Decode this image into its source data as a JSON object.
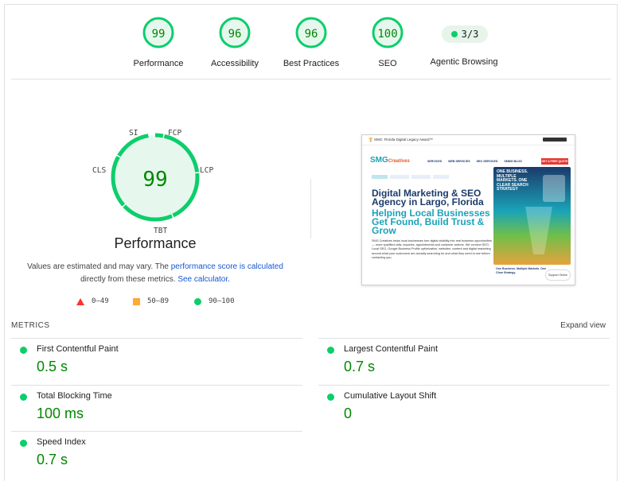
{
  "gauges": [
    {
      "label": "Performance",
      "score": "99"
    },
    {
      "label": "Accessibility",
      "score": "96"
    },
    {
      "label": "Best Practices",
      "score": "96"
    },
    {
      "label": "SEO",
      "score": "100"
    }
  ],
  "agentic": {
    "value": "3/3",
    "label": "Agentic Browsing"
  },
  "performance": {
    "score": "99",
    "title": "Performance",
    "metric_labels": {
      "si": "SI",
      "fcp": "FCP",
      "lcp": "LCP",
      "tbt": "TBT",
      "cls": "CLS"
    },
    "note_prefix": "Values are estimated and may vary. The ",
    "note_link1": "performance score is calculated",
    "note_middle": " directly from these metrics. ",
    "note_link2": "See calculator",
    "note_suffix": ".",
    "legend": [
      "0–49",
      "50–89",
      "90–100"
    ]
  },
  "screenshot": {
    "top_bar": "🏆 SMG: Florida Digital Legacy Award™",
    "logo": "SMG",
    "logo_script": "Creatives",
    "nav": [
      "SERVICES",
      "WEB SERVICES",
      "SEO SERVICES",
      "SMMG BLOG"
    ],
    "cta": "GET A FREE QUOTE",
    "heading_dark": "Digital Marketing & SEO Agency in Largo, Florida",
    "heading_teal": "Helping Local Businesses Get Found, Build Trust & Grow",
    "body": "SMG Creatives helps local businesses turn digital visibility into real business opportunities — more qualified calls, inquiries, appointments and customer actions. We connect SEO, Local SEO, Google Business Profile optimization, websites, content and digital marketing around what your customers are actually searching for and what they need to see before contacting you.",
    "side_title": "ONE BUSINESS. MULTIPLE MARKETS. ONE CLEAR SEARCH STRATEGY",
    "caption": "One Business. Multiple Markets. One Clear Strategy.",
    "support": "Support Online"
  },
  "metrics": {
    "heading": "METRICS",
    "expand": "Expand view",
    "items": [
      {
        "title": "First Contentful Paint",
        "value": "0.5 s"
      },
      {
        "title": "Largest Contentful Paint",
        "value": "0.7 s"
      },
      {
        "title": "Total Blocking Time",
        "value": "100 ms"
      },
      {
        "title": "Cumulative Layout Shift",
        "value": "0"
      },
      {
        "title": "Speed Index",
        "value": "0.7 s"
      }
    ]
  },
  "colors": {
    "pass": "#0cce6b",
    "pass_text": "#008800",
    "average": "#ffaa33",
    "fail": "#ff3333",
    "link": "#1558d6"
  }
}
